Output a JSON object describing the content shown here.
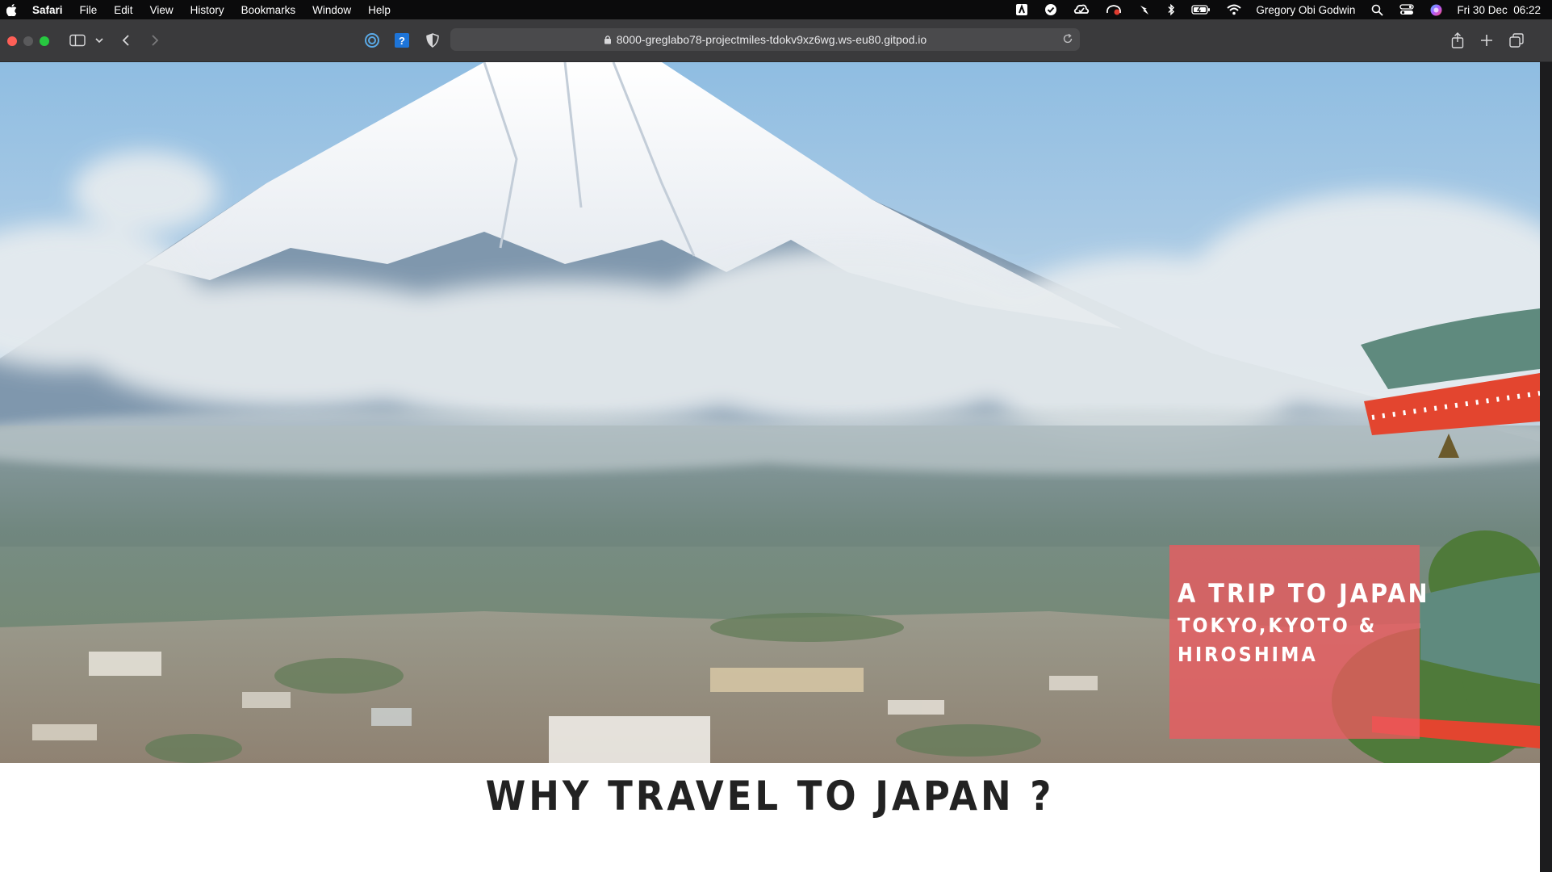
{
  "menubar": {
    "app": "Safari",
    "items": [
      "File",
      "Edit",
      "View",
      "History",
      "Bookmarks",
      "Window",
      "Help"
    ],
    "user": "Gregory Obi Godwin",
    "datetime": "Fri 30 Dec  06:22",
    "status_icons": [
      "adobe-icon",
      "check-circle-icon",
      "creative-cloud-icon",
      "cast-icon",
      "lightning-icon",
      "bluetooth-icon",
      "battery-icon",
      "wifi-icon",
      "search-icon",
      "control-center-icon",
      "siri-icon"
    ]
  },
  "browser": {
    "url": "8000-greglabo78-projectmiles-tdokv9xz6wg.ws-eu80.gitpod.io",
    "toolbar_icons": [
      "sidebar-icon",
      "chevron-down-icon",
      "back-icon",
      "forward-icon",
      "extension-1-icon",
      "extension-2-icon",
      "shield-icon",
      "lock-icon",
      "reload-icon",
      "share-icon",
      "new-tab-icon",
      "tabs-overview-icon"
    ],
    "colors": {
      "close": "#fe5f57",
      "minimize": "#5a5a5c",
      "maximize": "#27c840"
    }
  },
  "hero": {
    "title": "A TRIP TO JAPAN",
    "subtitle": "TOKYO,KYOTO & HIROSHIMA",
    "badge_color": "#ec5a5f"
  },
  "section": {
    "title": "WHY TRAVEL TO JAPAN ?"
  }
}
